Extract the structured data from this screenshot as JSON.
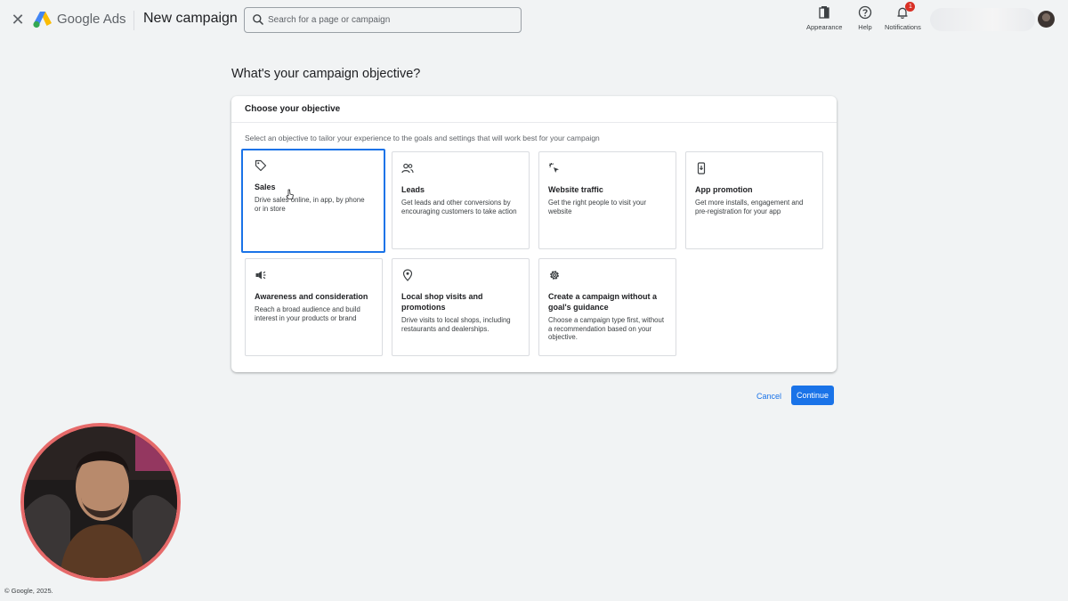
{
  "header": {
    "brand": "Google Ads",
    "page_title": "New campaign",
    "search_placeholder": "Search for a page or campaign",
    "tools": {
      "appearance": "Appearance",
      "help": "Help",
      "notifications": "Notifications",
      "notifications_count": "1"
    }
  },
  "main": {
    "heading": "What's your campaign objective?",
    "panel_title": "Choose your objective",
    "panel_description": "Select an objective to tailor your experience to the goals and settings that will work best for your campaign",
    "objectives": [
      {
        "title": "Sales",
        "description": "Drive sales online, in app, by phone or in store",
        "icon": "tag-icon",
        "selected": true
      },
      {
        "title": "Leads",
        "description": "Get leads and other conversions by encouraging customers to take action",
        "icon": "people-icon"
      },
      {
        "title": "Website traffic",
        "description": "Get the right people to visit your website",
        "icon": "cursor-click-icon"
      },
      {
        "title": "App promotion",
        "description": "Get more installs, engagement and pre-registration for your app",
        "icon": "phone-icon"
      },
      {
        "title": "Awareness and consideration",
        "description": "Reach a broad audience and build interest in your products or brand",
        "icon": "megaphone-icon"
      },
      {
        "title": "Local shop visits and promotions",
        "description": "Drive visits to local shops, including restaurants and dealerships.",
        "icon": "location-pin-icon"
      },
      {
        "title": "Create a campaign without a goal's guidance",
        "description": "Choose a campaign type first, without a recommendation based on your objective.",
        "icon": "gear-icon"
      }
    ],
    "cancel_label": "Cancel",
    "continue_label": "Continue"
  },
  "footer": {
    "copyright": "© Google, 2025."
  },
  "colors": {
    "accent": "#1a73e8",
    "background": "#f1f3f4",
    "notification_badge": "#d93025",
    "webcam_border": "#e66a6a"
  }
}
